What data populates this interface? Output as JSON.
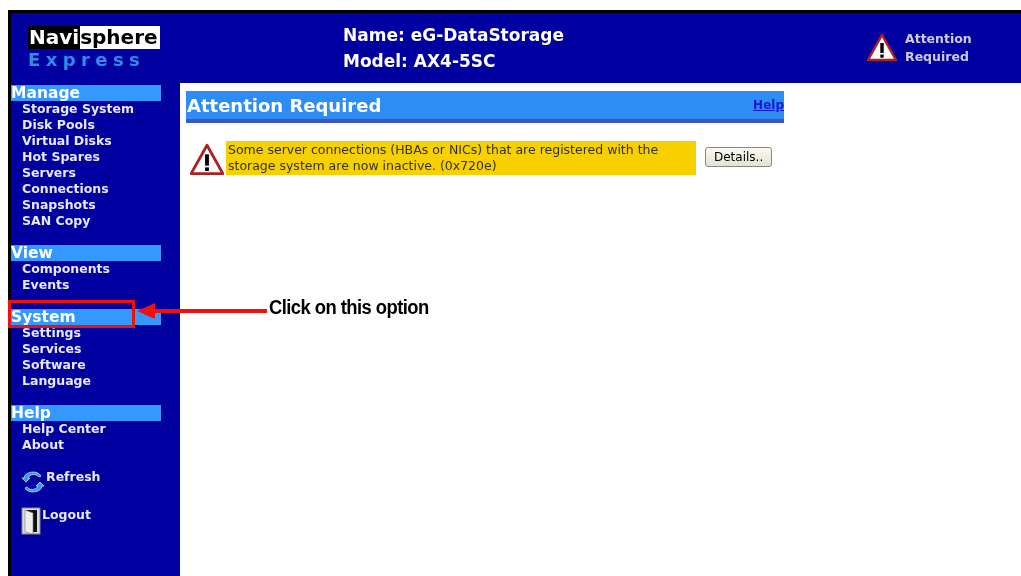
{
  "logo": {
    "part_1": "Navi",
    "part_2": "sphere",
    "subtitle": "Express"
  },
  "header": {
    "name": "Name: eG-DataStorage",
    "model": "Model: AX4-5SC",
    "alert": "Attention Required"
  },
  "sidebar": {
    "sections": [
      {
        "title": "Manage",
        "items": [
          "Storage System",
          "Disk Pools",
          "Virtual Disks",
          "Hot Spares",
          "Servers",
          "Connections",
          "Snapshots",
          "SAN Copy"
        ]
      },
      {
        "title": "View",
        "items": [
          "Components",
          "Events"
        ]
      },
      {
        "title": "System",
        "items": [
          "Settings",
          "Services",
          "Software",
          "Language"
        ]
      },
      {
        "title": "Help",
        "items": [
          "Help Center",
          "About"
        ]
      }
    ],
    "actions": [
      {
        "kind": "refresh",
        "label": "Refresh"
      },
      {
        "kind": "logout",
        "label": "Logout"
      }
    ]
  },
  "panel": {
    "title": "Attention Required",
    "help": "Help",
    "message": "Some server connections (HBAs or NICs) that are registered with the storage system are now inactive. (0x720e)",
    "button": "Details.."
  },
  "annotation": {
    "text": "Click on this option"
  }
}
